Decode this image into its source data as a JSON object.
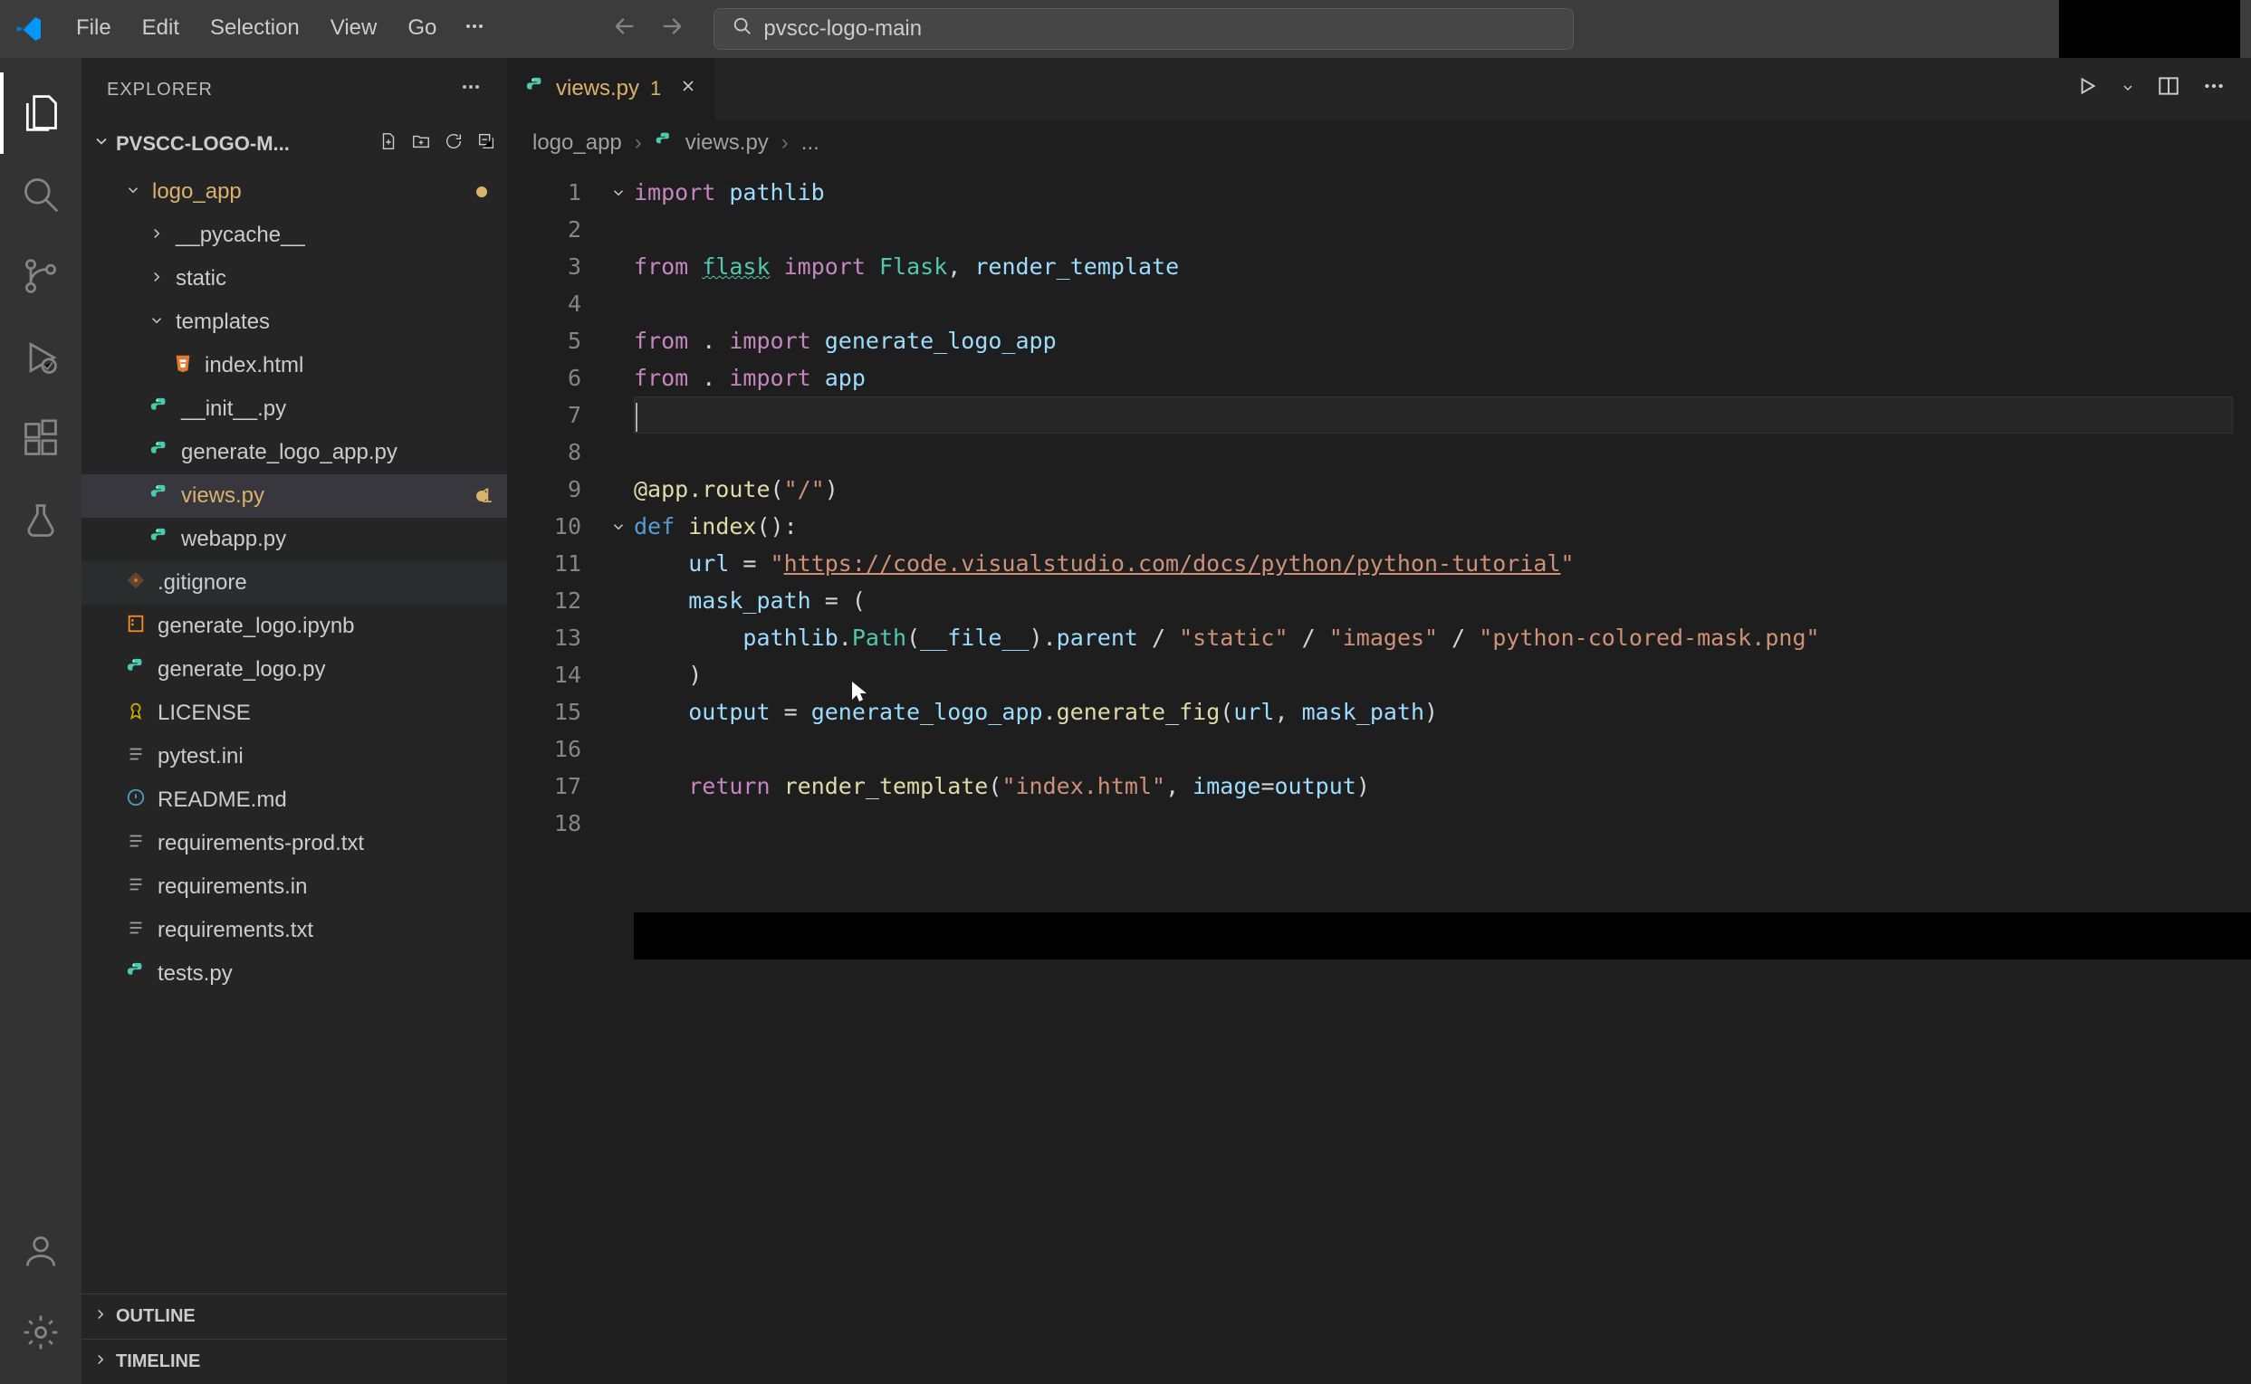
{
  "title_bar": {
    "menu": [
      "File",
      "Edit",
      "Selection",
      "View",
      "Go"
    ],
    "search_value": "pvscc-logo-main"
  },
  "activity_bar": {
    "items": [
      {
        "name": "explorer-icon",
        "active": true
      },
      {
        "name": "search-icon",
        "active": false
      },
      {
        "name": "source-control-icon",
        "active": false
      },
      {
        "name": "run-debug-icon",
        "active": false
      },
      {
        "name": "extensions-icon",
        "active": false
      },
      {
        "name": "testing-icon",
        "active": false
      }
    ],
    "bottom": [
      {
        "name": "accounts-icon"
      },
      {
        "name": "settings-gear-icon"
      }
    ]
  },
  "sidebar": {
    "title": "EXPLORER",
    "folder_name": "PVSCC-LOGO-M...",
    "tree": [
      {
        "kind": "folder",
        "depth": 1,
        "name": "logo_app",
        "open": true,
        "modified": true
      },
      {
        "kind": "folder",
        "depth": 2,
        "name": "__pycache__",
        "open": false
      },
      {
        "kind": "folder",
        "depth": 2,
        "name": "static",
        "open": false
      },
      {
        "kind": "folder",
        "depth": 2,
        "name": "templates",
        "open": true
      },
      {
        "kind": "file",
        "depth": 3,
        "name": "index.html",
        "icon": "html"
      },
      {
        "kind": "file",
        "depth": 2,
        "name": "__init__.py",
        "icon": "py"
      },
      {
        "kind": "file",
        "depth": 2,
        "name": "generate_logo_app.py",
        "icon": "py"
      },
      {
        "kind": "file",
        "depth": 2,
        "name": "views.py",
        "icon": "py",
        "selected": true,
        "modified": true,
        "badge": "1"
      },
      {
        "kind": "file",
        "depth": 2,
        "name": "webapp.py",
        "icon": "py"
      },
      {
        "kind": "file",
        "depth": 1,
        "name": ".gitignore",
        "icon": "git",
        "hovered": true
      },
      {
        "kind": "file",
        "depth": 1,
        "name": "generate_logo.ipynb",
        "icon": "nb"
      },
      {
        "kind": "file",
        "depth": 1,
        "name": "generate_logo.py",
        "icon": "py"
      },
      {
        "kind": "file",
        "depth": 1,
        "name": "LICENSE",
        "icon": "lic"
      },
      {
        "kind": "file",
        "depth": 1,
        "name": "pytest.ini",
        "icon": "txt"
      },
      {
        "kind": "file",
        "depth": 1,
        "name": "README.md",
        "icon": "md"
      },
      {
        "kind": "file",
        "depth": 1,
        "name": "requirements-prod.txt",
        "icon": "txt"
      },
      {
        "kind": "file",
        "depth": 1,
        "name": "requirements.in",
        "icon": "txt"
      },
      {
        "kind": "file",
        "depth": 1,
        "name": "requirements.txt",
        "icon": "txt"
      },
      {
        "kind": "file",
        "depth": 1,
        "name": "tests.py",
        "icon": "py"
      }
    ],
    "panes": {
      "outline": "OUTLINE",
      "timeline": "TIMELINE"
    }
  },
  "tabs": [
    {
      "label": "views.py",
      "icon": "py",
      "badge": "1",
      "modified": true
    }
  ],
  "breadcrumb": [
    "logo_app",
    "views.py",
    "..."
  ],
  "code": {
    "lines": [
      {
        "n": 1,
        "tokens": [
          [
            "kw",
            "import"
          ],
          [
            "op",
            " "
          ],
          [
            "id",
            "pathlib"
          ]
        ]
      },
      {
        "n": 2,
        "tokens": []
      },
      {
        "n": 3,
        "tokens": [
          [
            "kw",
            "from"
          ],
          [
            "op",
            " "
          ],
          [
            "mod",
            "flask"
          ],
          [
            "op",
            " "
          ],
          [
            "kw",
            "import"
          ],
          [
            "op",
            " "
          ],
          [
            "cls",
            "Flask"
          ],
          [
            "op",
            ", "
          ],
          [
            "id",
            "render_template"
          ]
        ]
      },
      {
        "n": 4,
        "tokens": []
      },
      {
        "n": 5,
        "tokens": [
          [
            "kw",
            "from"
          ],
          [
            "op",
            " . "
          ],
          [
            "kw",
            "import"
          ],
          [
            "op",
            " "
          ],
          [
            "id",
            "generate_logo_app"
          ]
        ]
      },
      {
        "n": 6,
        "tokens": [
          [
            "kw",
            "from"
          ],
          [
            "op",
            " . "
          ],
          [
            "kw",
            "import"
          ],
          [
            "op",
            " "
          ],
          [
            "id",
            "app"
          ]
        ]
      },
      {
        "n": 7,
        "tokens": [],
        "current": true
      },
      {
        "n": 8,
        "tokens": []
      },
      {
        "n": 9,
        "tokens": [
          [
            "dec",
            "@app.route"
          ],
          [
            "op",
            "("
          ],
          [
            "str",
            "\"/\""
          ],
          [
            "op",
            ")"
          ]
        ]
      },
      {
        "n": 10,
        "tokens": [
          [
            "def",
            "def"
          ],
          [
            "op",
            " "
          ],
          [
            "fn",
            "index"
          ],
          [
            "op",
            "():"
          ]
        ],
        "fold": true
      },
      {
        "n": 11,
        "tokens": [
          [
            "op",
            "    "
          ],
          [
            "id",
            "url"
          ],
          [
            "op",
            " = "
          ],
          [
            "str",
            "\""
          ],
          [
            "str-u",
            "https://code.visualstudio.com/docs/python/python-tutorial"
          ],
          [
            "str",
            "\""
          ]
        ]
      },
      {
        "n": 12,
        "tokens": [
          [
            "op",
            "    "
          ],
          [
            "id",
            "mask_path"
          ],
          [
            "op",
            " = ("
          ]
        ]
      },
      {
        "n": 13,
        "tokens": [
          [
            "op",
            "        "
          ],
          [
            "id",
            "pathlib"
          ],
          [
            "op",
            "."
          ],
          [
            "cls",
            "Path"
          ],
          [
            "op",
            "("
          ],
          [
            "id",
            "__file__"
          ],
          [
            "op",
            ")."
          ],
          [
            "id",
            "parent"
          ],
          [
            "op",
            " / "
          ],
          [
            "str",
            "\"static\""
          ],
          [
            "op",
            " / "
          ],
          [
            "str",
            "\"images\""
          ],
          [
            "op",
            " / "
          ],
          [
            "str",
            "\"python-colored-mask.png\""
          ]
        ]
      },
      {
        "n": 14,
        "tokens": [
          [
            "op",
            "    )"
          ]
        ]
      },
      {
        "n": 15,
        "tokens": [
          [
            "op",
            "    "
          ],
          [
            "id",
            "output"
          ],
          [
            "op",
            " = "
          ],
          [
            "id",
            "generate_logo_app"
          ],
          [
            "op",
            "."
          ],
          [
            "fn",
            "generate_fig"
          ],
          [
            "op",
            "("
          ],
          [
            "id",
            "url"
          ],
          [
            "op",
            ", "
          ],
          [
            "id",
            "mask_path"
          ],
          [
            "op",
            ")"
          ]
        ]
      },
      {
        "n": 16,
        "tokens": []
      },
      {
        "n": 17,
        "tokens": [
          [
            "op",
            "    "
          ],
          [
            "kw",
            "return"
          ],
          [
            "op",
            " "
          ],
          [
            "fn",
            "render_template"
          ],
          [
            "op",
            "("
          ],
          [
            "str",
            "\"index.html\""
          ],
          [
            "op",
            ", "
          ],
          [
            "id",
            "image"
          ],
          [
            "op",
            "="
          ],
          [
            "id",
            "output"
          ],
          [
            "op",
            ")"
          ]
        ]
      },
      {
        "n": 18,
        "tokens": []
      }
    ]
  }
}
